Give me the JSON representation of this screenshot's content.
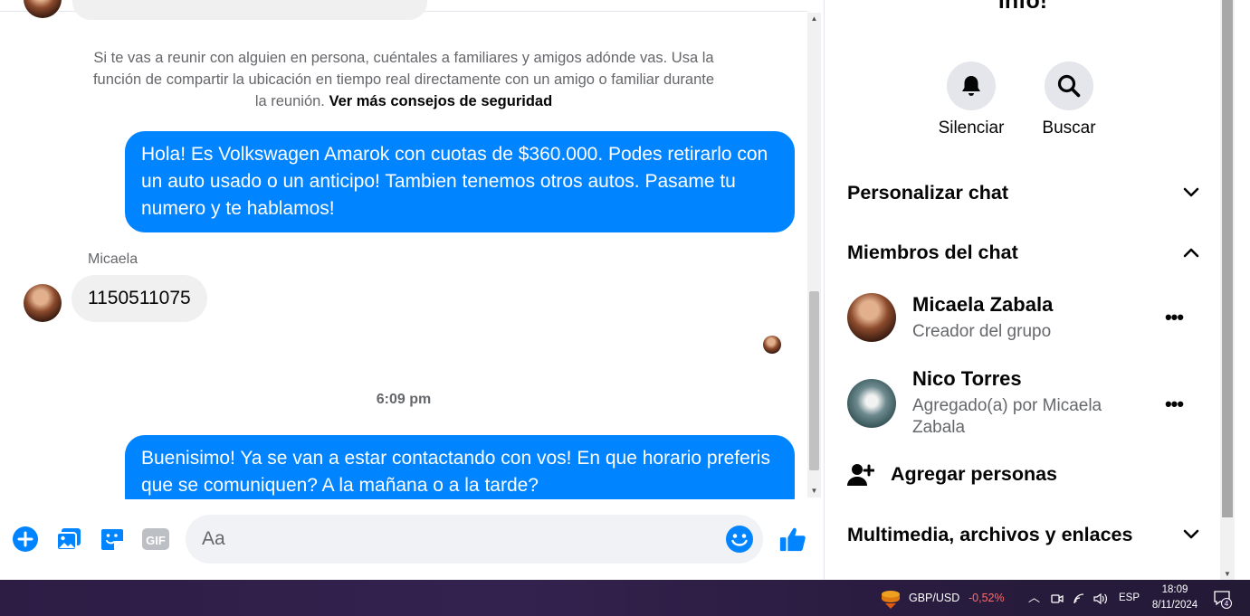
{
  "chat": {
    "safety_notice": "Si te vas a reunir con alguien en persona, cuéntales a familiares y amigos adónde vas. Usa la función de compartir la ubicación en tiempo real directamente con un amigo o familiar durante la reunión.",
    "safety_link": "Ver más consejos de seguridad",
    "messages": [
      {
        "direction": "outgoing",
        "text": "Hola! Es Volkswagen Amarok con cuotas de $360.000. Podes retirarlo con un auto usado o un anticipo! Tambien tenemos otros autos. Pasame tu numero y te hablamos!"
      },
      {
        "direction": "incoming",
        "sender": "Micaela",
        "text": "1150511075"
      },
      {
        "direction": "outgoing",
        "text": "Buenisimo! Ya se van a estar contactando con vos! En que horario preferis que se comuniquen? A la mañana o a la tarde?"
      }
    ],
    "timestamp": "6:09 pm"
  },
  "composer": {
    "placeholder": "Aa",
    "icons": [
      "plus-circle-icon",
      "photo-icon",
      "sticker-icon",
      "gif-icon",
      "emoji-icon",
      "thumbs-up-icon"
    ],
    "gif_label": "GIF"
  },
  "info_panel": {
    "title": "info!",
    "actions": [
      {
        "label": "Silenciar",
        "icon": "bell-icon"
      },
      {
        "label": "Buscar",
        "icon": "search-icon"
      }
    ],
    "sections": {
      "customize": "Personalizar chat",
      "members": "Miembros del chat",
      "media": "Multimedia, archivos y enlaces"
    },
    "members": [
      {
        "name": "Micaela Zabala",
        "subtitle": "Creador del grupo"
      },
      {
        "name": "Nico Torres",
        "subtitle": "Agregado(a) por Micaela Zabala"
      }
    ],
    "more_label": "•••",
    "add_people": "Agregar personas"
  },
  "taskbar": {
    "ticker_symbol": "GBP/USD",
    "ticker_change": "-0,52%",
    "language": "ESP",
    "time": "18:09",
    "date": "8/11/2024",
    "notification_count": "4"
  },
  "colors": {
    "accent": "#0084ff",
    "incoming_bubble": "#f0f0f0",
    "ticker_negative": "#ff6b6b"
  }
}
